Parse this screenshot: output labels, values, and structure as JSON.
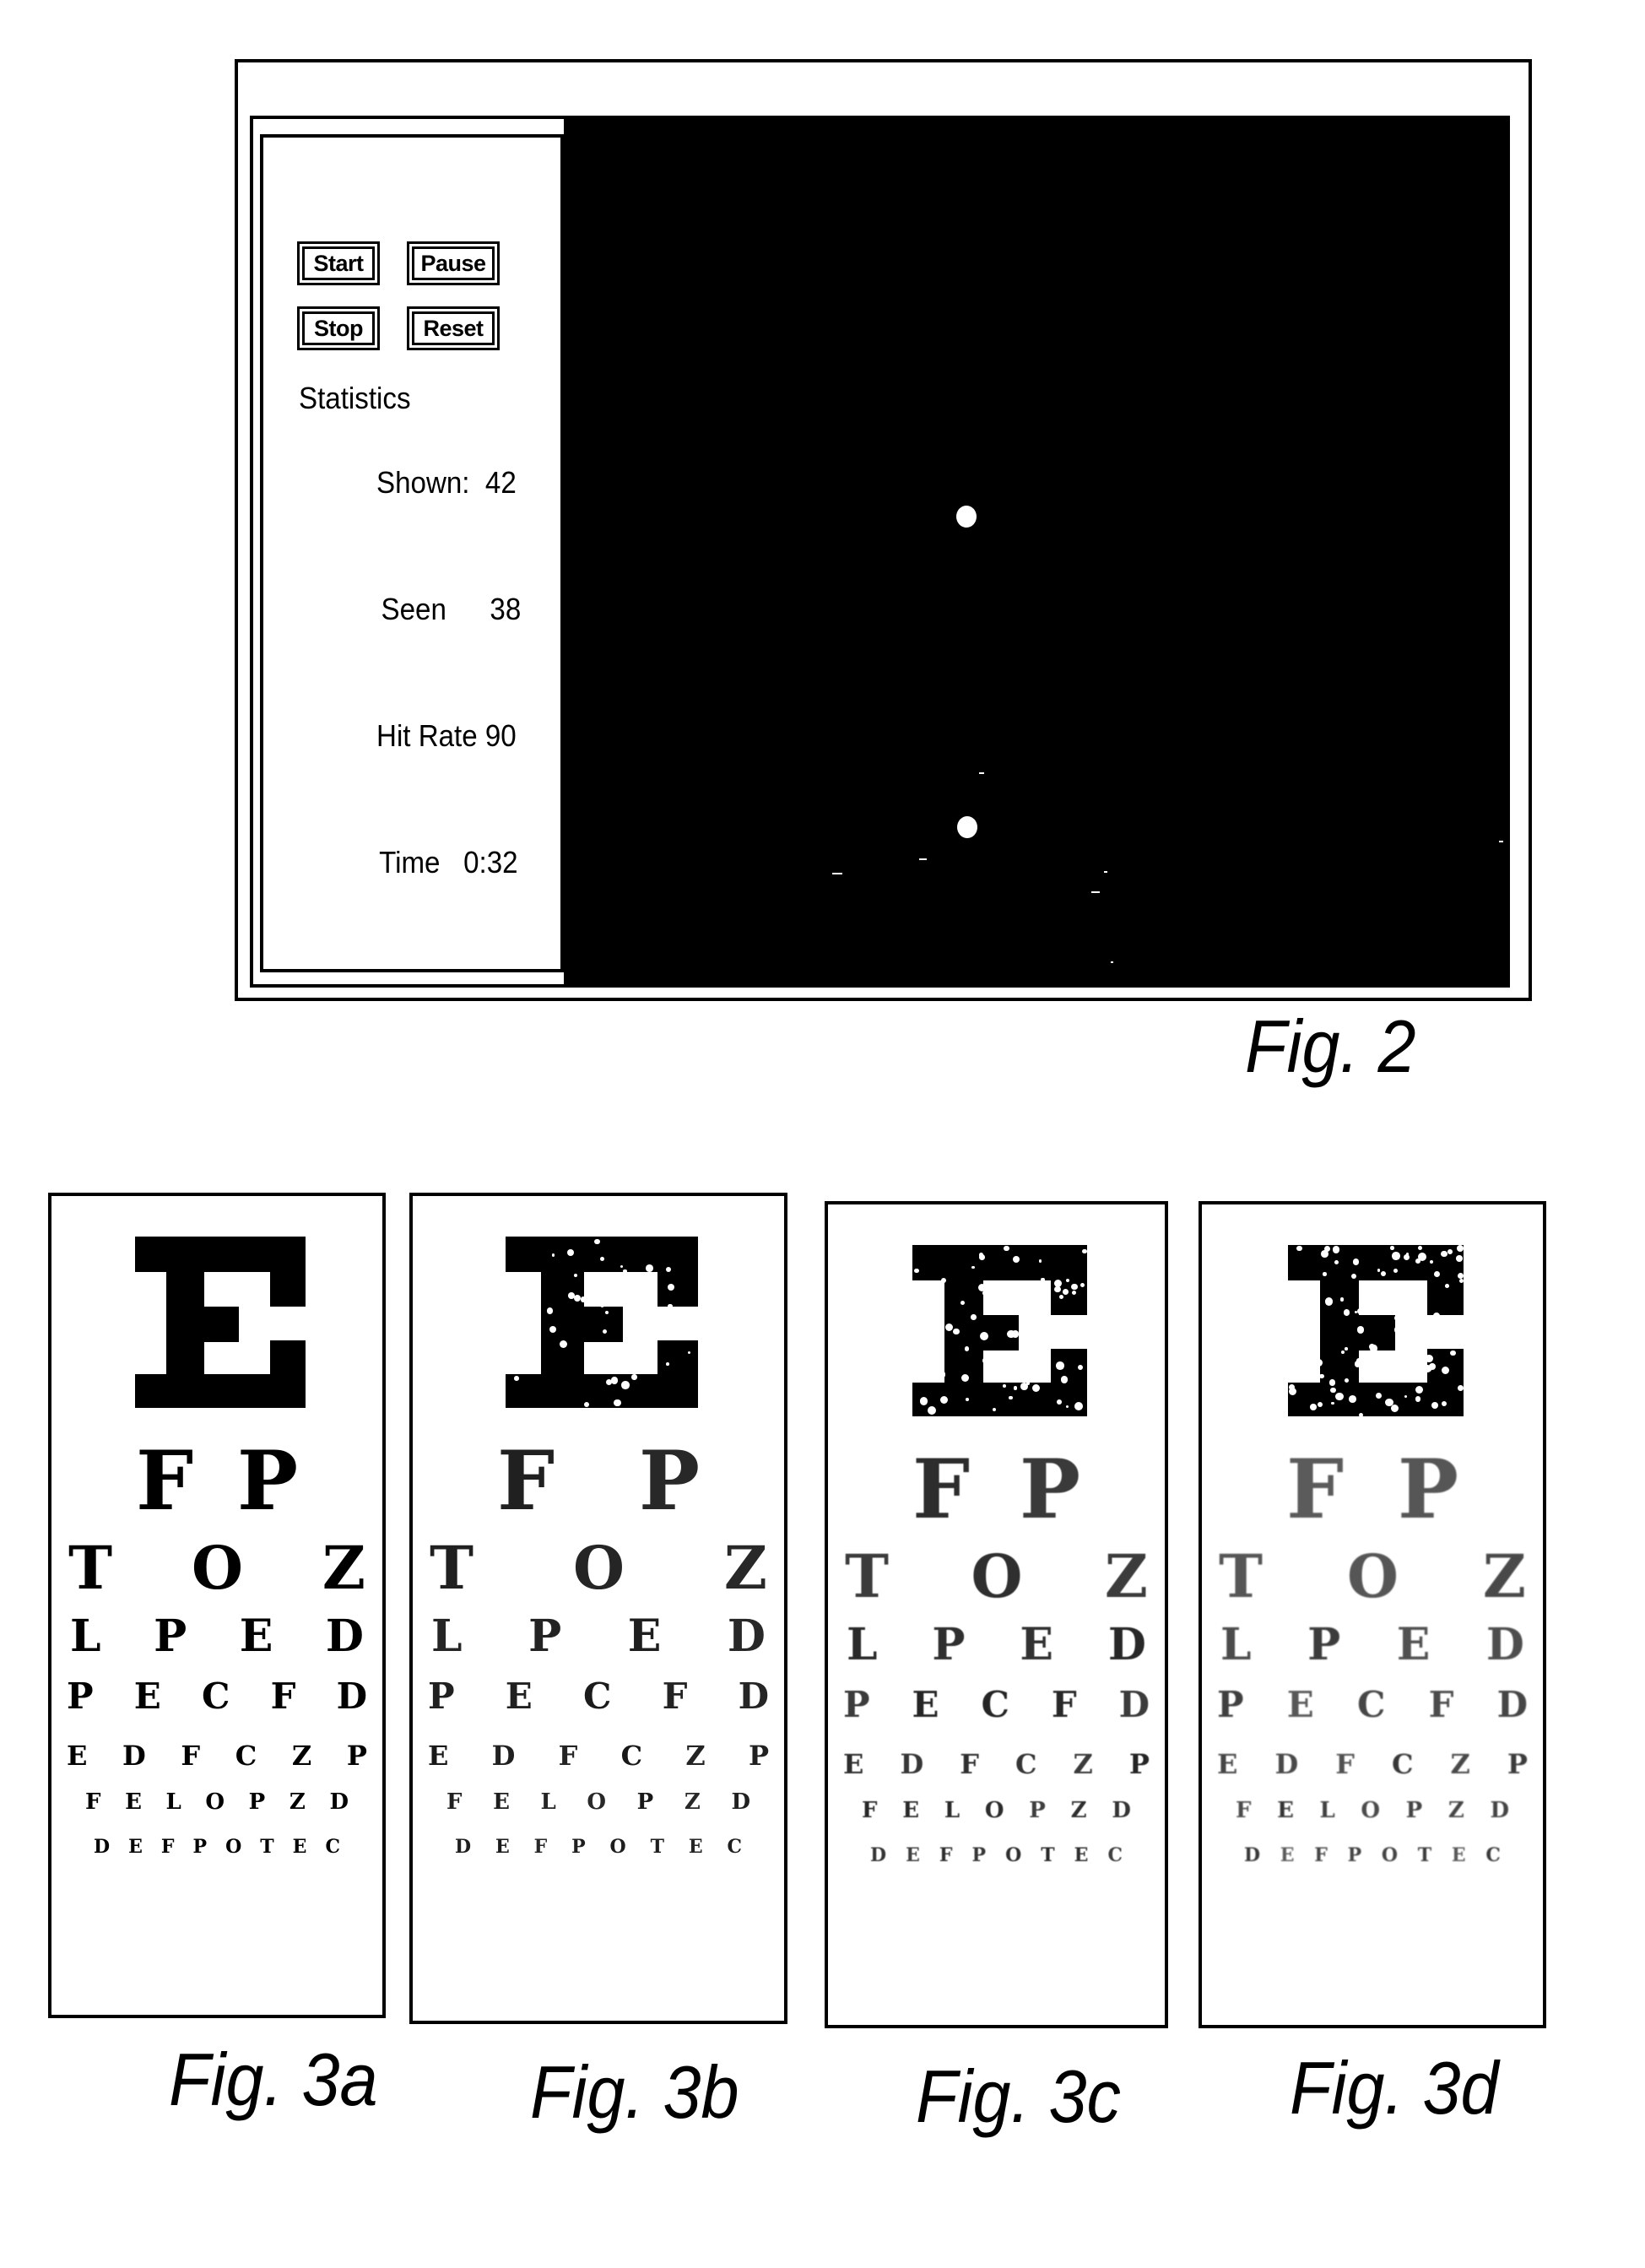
{
  "fig2": {
    "caption": "Fig. 2",
    "controls": {
      "start_label": "Start",
      "pause_label": "Pause",
      "stop_label": "Stop",
      "reset_label": "Reset"
    },
    "statistics": {
      "heading": "Statistics",
      "rows": [
        {
          "label": "Shown:",
          "value": "42"
        },
        {
          "label": "Seen",
          "value": "38"
        },
        {
          "label": "Hit Rate",
          "value": "90"
        },
        {
          "label": "Time",
          "value": "0:32"
        }
      ]
    },
    "display": {
      "background": "#000000",
      "stimulus_color": "#ffffff",
      "stimulus_count": 2
    }
  },
  "eye_charts": {
    "rows": [
      [
        "E"
      ],
      [
        "F",
        "P"
      ],
      [
        "T",
        "O",
        "Z"
      ],
      [
        "L",
        "P",
        "E",
        "D"
      ],
      [
        "P",
        "E",
        "C",
        "F",
        "D"
      ],
      [
        "E",
        "D",
        "F",
        "C",
        "Z",
        "P"
      ],
      [
        "F",
        "E",
        "L",
        "O",
        "P",
        "Z",
        "D"
      ],
      [
        "D",
        "E",
        "F",
        "P",
        "O",
        "T",
        "E",
        "C"
      ]
    ],
    "panels": [
      {
        "caption": "Fig. 3a",
        "degradation": "none"
      },
      {
        "caption": "Fig. 3b",
        "degradation": "light"
      },
      {
        "caption": "Fig. 3c",
        "degradation": "moderate"
      },
      {
        "caption": "Fig. 3d",
        "degradation": "heavy"
      }
    ]
  }
}
